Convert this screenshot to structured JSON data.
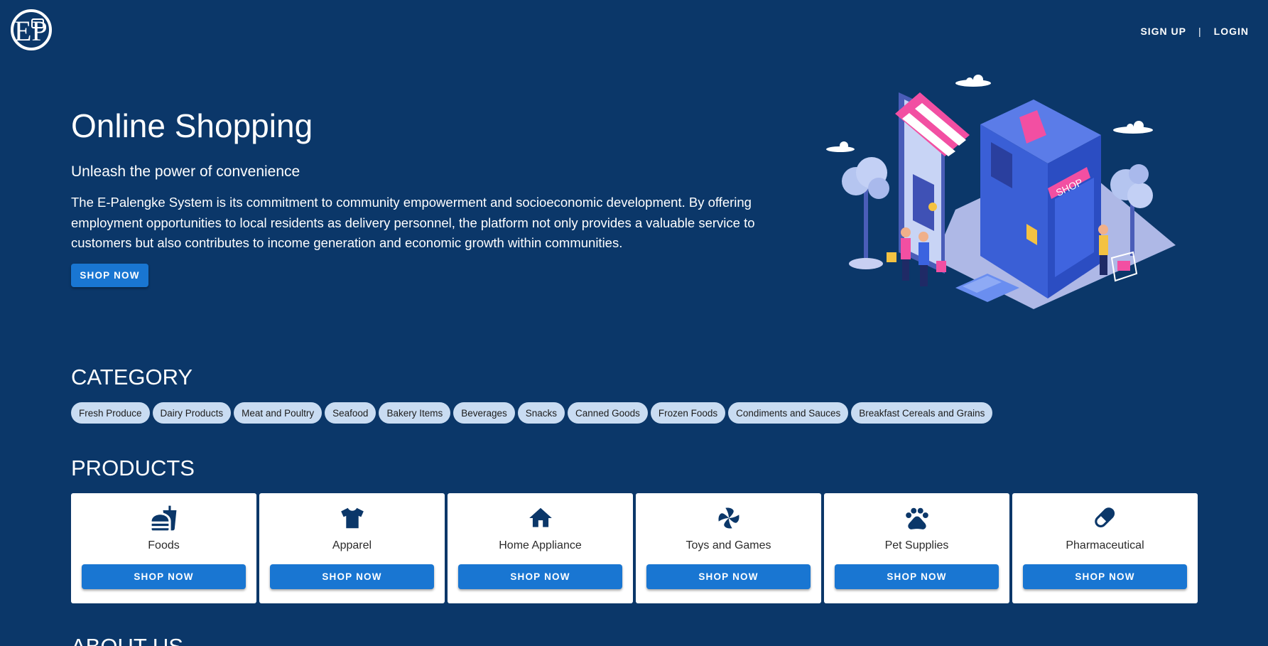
{
  "header": {
    "logo_text": "EP",
    "signup_label": "SIGN UP",
    "separator": "|",
    "login_label": "LOGIN"
  },
  "hero": {
    "title": "Online Shopping",
    "subtitle": "Unleash the power of convenience",
    "description": "The E-Palengke System is its commitment to community empowerment and socioeconomic development. By offering employment opportunities to local residents as delivery personnel, the platform not only provides a valuable service to customers but also contributes to income generation and economic growth within communities.",
    "button_label": "SHOP NOW",
    "illustration_sign": "SHOP"
  },
  "category": {
    "title": "CATEGORY",
    "items": [
      "Fresh Produce",
      "Dairy Products",
      "Meat and Poultry",
      "Seafood",
      "Bakery Items",
      "Beverages",
      "Snacks",
      "Canned Goods",
      "Frozen Foods",
      "Condiments and Sauces",
      "Breakfast Cereals and Grains"
    ]
  },
  "products": {
    "title": "PRODUCTS",
    "items": [
      {
        "label": "Foods",
        "icon": "fastfood-icon",
        "button": "SHOP NOW"
      },
      {
        "label": "Apparel",
        "icon": "tshirt-icon",
        "button": "SHOP NOW"
      },
      {
        "label": "Home Appliance",
        "icon": "home-icon",
        "button": "SHOP NOW"
      },
      {
        "label": "Toys and Games",
        "icon": "pinwheel-icon",
        "button": "SHOP NOW"
      },
      {
        "label": "Pet Supplies",
        "icon": "paw-icon",
        "button": "SHOP NOW"
      },
      {
        "label": "Pharmaceutical",
        "icon": "pill-icon",
        "button": "SHOP NOW"
      }
    ]
  },
  "about": {
    "title": "ABOUT US"
  },
  "colors": {
    "background": "#0b3769",
    "accent": "#1976d2",
    "chip": "#c9dcf2",
    "icon": "#0b3769"
  }
}
